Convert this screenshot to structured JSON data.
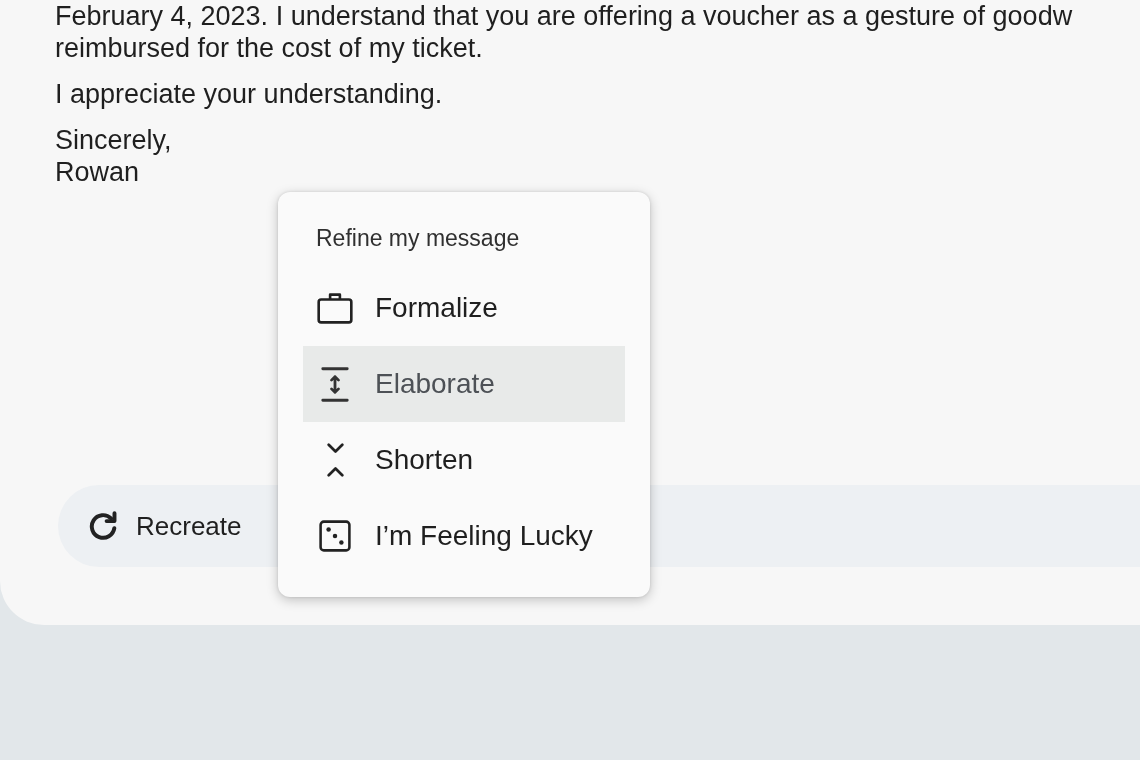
{
  "letter": {
    "partial_paragraph": [
      "February 4, 2023. I understand that you are offering a voucher as a gesture of goodw",
      "reimbursed for the cost of my ticket."
    ],
    "paragraph": "I appreciate your understanding.",
    "closing": "Sincerely,",
    "signature": "Rowan"
  },
  "action_bar": {
    "buttons": [
      {
        "label": "Recreate"
      }
    ]
  },
  "refine_menu": {
    "title": "Refine my message",
    "items": [
      {
        "label": "Formalize",
        "selected": false
      },
      {
        "label": "Elaborate",
        "selected": true
      },
      {
        "label": "Shorten",
        "selected": false
      },
      {
        "label": "I’m Feeling Lucky",
        "selected": false
      }
    ]
  }
}
